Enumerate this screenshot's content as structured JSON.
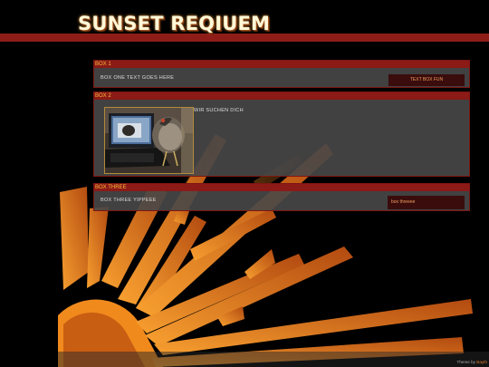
{
  "header": {
    "title": "SUNSET REQIUEM"
  },
  "box1": {
    "heading": "BOX 1",
    "text": "BOX ONE TEXT GOES HERE",
    "button": "TEXT BOX FUN"
  },
  "box2": {
    "heading": "BOX 2",
    "text": "WIR SUCHEN DICH"
  },
  "box3": {
    "heading": "BOX THREE",
    "text": "BOX THREE YIPPEEE",
    "button": "box threeee"
  },
  "footer": {
    "credit_prefix": "Theme by ",
    "credit_link": "Bayth"
  },
  "colors": {
    "accent": "#8e1d18",
    "heading_text": "#f4bb3a",
    "sun": "#f08a20"
  },
  "icons": {
    "background": "sunburst-illustration",
    "photo": "bird-on-laptop-photo"
  }
}
